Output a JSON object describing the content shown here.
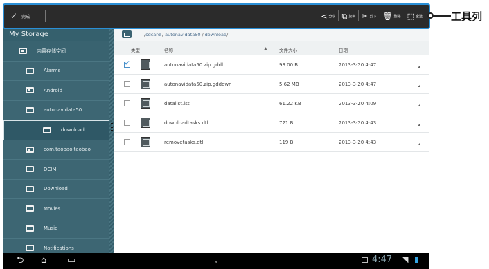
{
  "actionbar": {
    "done_label": "完成",
    "actions": [
      {
        "name": "share",
        "icon": "share-icon",
        "glyph": "<",
        "label": "分享"
      },
      {
        "name": "copy",
        "icon": "copy-icon",
        "glyph": "⧉",
        "label": "复制"
      },
      {
        "name": "cut",
        "icon": "scissors-icon",
        "glyph": "✂",
        "label": "剪下"
      },
      {
        "name": "delete",
        "icon": "trash-icon",
        "glyph": "🗑",
        "label": "删除"
      },
      {
        "name": "select-all",
        "icon": "select-all-icon",
        "glyph": "⬚",
        "label": "全选"
      }
    ]
  },
  "callout": {
    "label": "工具列"
  },
  "sidebar": {
    "title": "My Storage",
    "items": [
      {
        "label": "内置存储空间",
        "level": 0,
        "icon": "storage-icon"
      },
      {
        "label": "Alarms",
        "level": 1,
        "icon": "folder-icon"
      },
      {
        "label": "Android",
        "level": 1,
        "icon": "folder-icon"
      },
      {
        "label": "autonavidata50",
        "level": 1,
        "icon": "folder-icon"
      },
      {
        "label": "download",
        "level": 2,
        "icon": "folder-icon",
        "current": true
      },
      {
        "label": "com.taobao.taobao",
        "level": 1,
        "icon": "folder-icon"
      },
      {
        "label": "DCIM",
        "level": 1,
        "icon": "folder-icon"
      },
      {
        "label": "Download",
        "level": 1,
        "icon": "folder-icon"
      },
      {
        "label": "Movies",
        "level": 1,
        "icon": "folder-icon"
      },
      {
        "label": "Music",
        "level": 1,
        "icon": "folder-icon"
      },
      {
        "label": "Notifications",
        "level": 1,
        "icon": "folder-icon"
      }
    ]
  },
  "path": {
    "prefix": "/ ",
    "segments": [
      "sdcard",
      "autonavidata50",
      "download"
    ],
    "suffix": " /"
  },
  "table": {
    "headers": {
      "type": "类型",
      "name": "名称",
      "size": "文件大小",
      "date": "日期"
    },
    "rows": [
      {
        "checked": true,
        "name": "autonavidata50.zip.gddl",
        "size": "93.00 B",
        "date": "2013-3-20 4:47"
      },
      {
        "checked": false,
        "name": "autonavidata50.zip.gddown",
        "size": "5.62 MB",
        "date": "2013-3-20 4:47"
      },
      {
        "checked": false,
        "name": "datalist.lst",
        "size": "61.22 KB",
        "date": "2013-3-20 4:09"
      },
      {
        "checked": false,
        "name": "downloadtasks.dtl",
        "size": "721 B",
        "date": "2013-3-20 4:43"
      },
      {
        "checked": false,
        "name": "removetasks.dtl",
        "size": "119 B",
        "date": "2013-3-20 4:43"
      }
    ]
  },
  "status": {
    "time": "4:47"
  },
  "colors": {
    "accent": "#2a8fd6",
    "sidebar": "#3d6673",
    "actionbar": "#2b2b2b"
  }
}
